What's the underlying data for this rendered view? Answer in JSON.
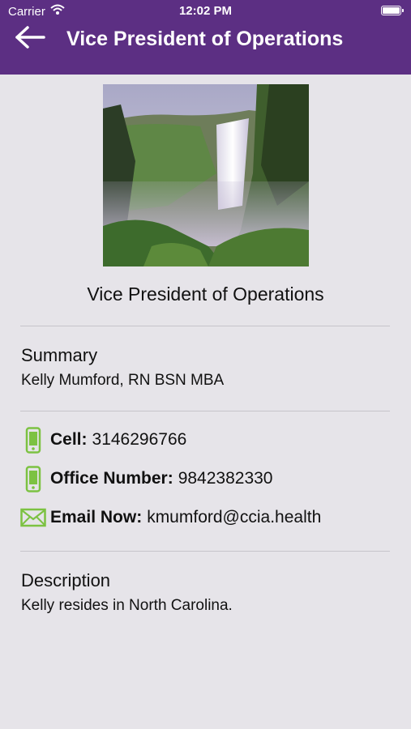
{
  "status_bar": {
    "carrier": "Carrier",
    "time": "12:02 PM"
  },
  "nav": {
    "title": "Vice President of Operations",
    "back_icon": "arrow-left-icon"
  },
  "profile": {
    "photo_icon": "waterfall-photo",
    "title": "Vice President of Operations"
  },
  "summary": {
    "heading": "Summary",
    "text": "Kelly Mumford, RN BSN MBA"
  },
  "contacts": [
    {
      "icon": "phone-icon",
      "label": "Cell:",
      "value": "3146296766"
    },
    {
      "icon": "phone-icon",
      "label": "Office Number:",
      "value": "9842382330"
    },
    {
      "icon": "envelope-icon",
      "label": "Email Now:",
      "value": "kmumford@ccia.health"
    }
  ],
  "description": {
    "heading": "Description",
    "text": "Kelly resides in North Carolina."
  },
  "colors": {
    "header": "#5c2f83",
    "background": "#e6e4e9",
    "icon_green": "#7cc242"
  }
}
